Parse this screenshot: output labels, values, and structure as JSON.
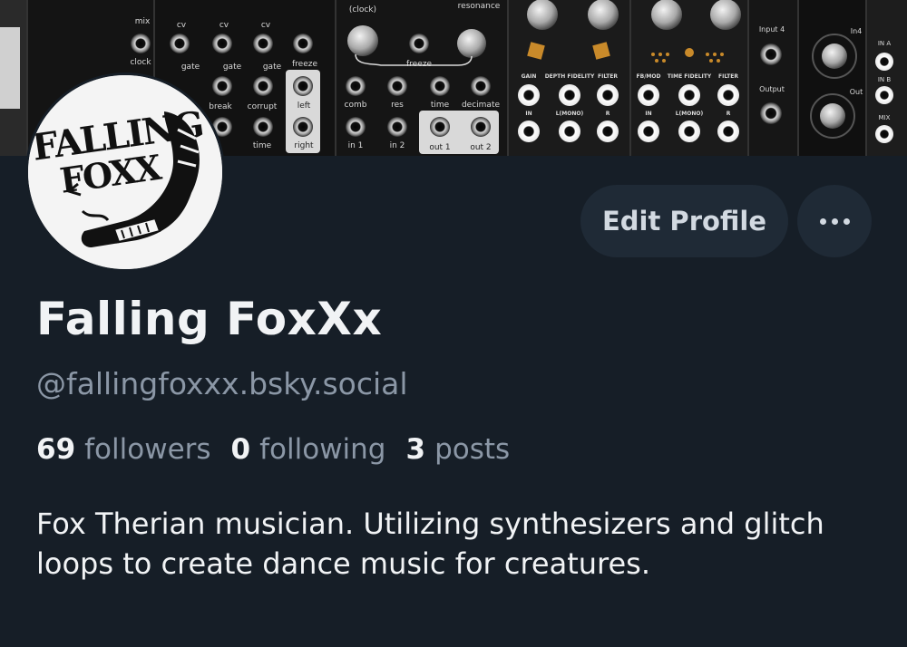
{
  "banner": {
    "labels": [
      "mix",
      "cv",
      "cv",
      "cv",
      "clock",
      "gate",
      "gate",
      "gate",
      "freeze",
      "break",
      "corrupt",
      "left",
      "time",
      "right",
      "(clock)",
      "resonance",
      "freeze",
      "comb",
      "res",
      "time",
      "decimate",
      "in 1",
      "in 2",
      "out 1",
      "out 2",
      "GAIN",
      "DEPTH FIDELITY",
      "FILTER",
      "FB/MOD",
      "TIME FIDELITY",
      "FILTER",
      "IN",
      "L(MONO)",
      "R",
      "IN",
      "L(MONO)",
      "R",
      "Input 4",
      "Output",
      "In4",
      "Out",
      "IN A",
      "IN B",
      "MIX"
    ]
  },
  "avatar": {
    "text_line1": "FALLING",
    "text_line2": "FOXX"
  },
  "profile": {
    "display_name": "Falling FoxXx",
    "handle": "@fallingfoxxx.bsky.social",
    "edit_label": "Edit Profile",
    "followers_count": "69",
    "followers_label": "followers",
    "following_count": "0",
    "following_label": "following",
    "posts_count": "3",
    "posts_label": "posts",
    "bio": "Fox Therian musician. Utilizing synthesizers and glitch loops to create dance music for creatures."
  },
  "colors": {
    "background": "#161e27",
    "button_bg": "#1f2a36",
    "muted_text": "#8b97a6",
    "primary_text": "#f1f3f5"
  },
  "icons": {
    "more": "ellipsis-icon"
  }
}
